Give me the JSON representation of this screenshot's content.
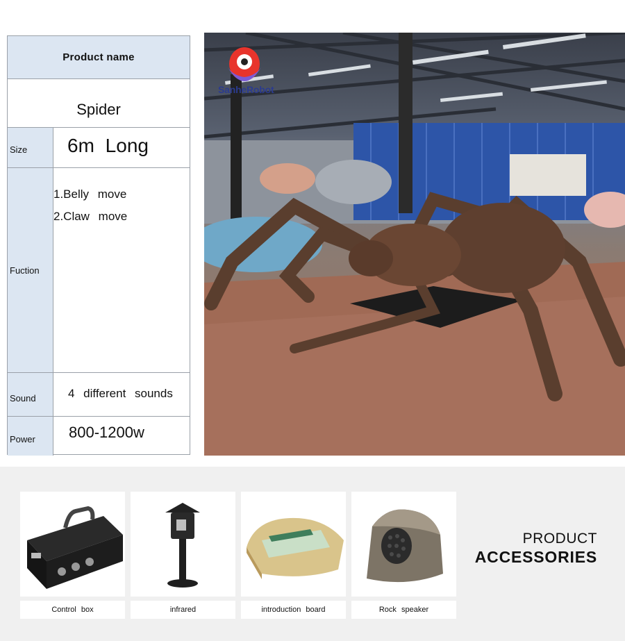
{
  "spec": {
    "product_name_label": "Product  name",
    "product_name": "Spider",
    "size_label": "Size",
    "size_value": "6m  Long",
    "function_label": "Fuction",
    "functions": [
      "1.Belly  move",
      "2.Claw  move"
    ],
    "sound_label": "Sound",
    "sound_value": "4  different  sounds",
    "power_label": "Power",
    "power_value": "800-1200w"
  },
  "photo": {
    "brand": "SanheRobot"
  },
  "accessories": {
    "title_line1": "PRODUCT",
    "title_line2": "ACCESSORIES",
    "items": [
      {
        "label": "Control  box",
        "icon": "control-box-icon"
      },
      {
        "label": "infrared",
        "icon": "infrared-sensor-icon"
      },
      {
        "label": "introduction  board",
        "icon": "introduction-board-icon"
      },
      {
        "label": "Rock  speaker",
        "icon": "rock-speaker-icon"
      }
    ]
  },
  "colors": {
    "label_bg": "#dce6f2",
    "border": "#9aa0a8",
    "brand_red": "#e8342c",
    "brand_purple": "#7b5bd6"
  }
}
